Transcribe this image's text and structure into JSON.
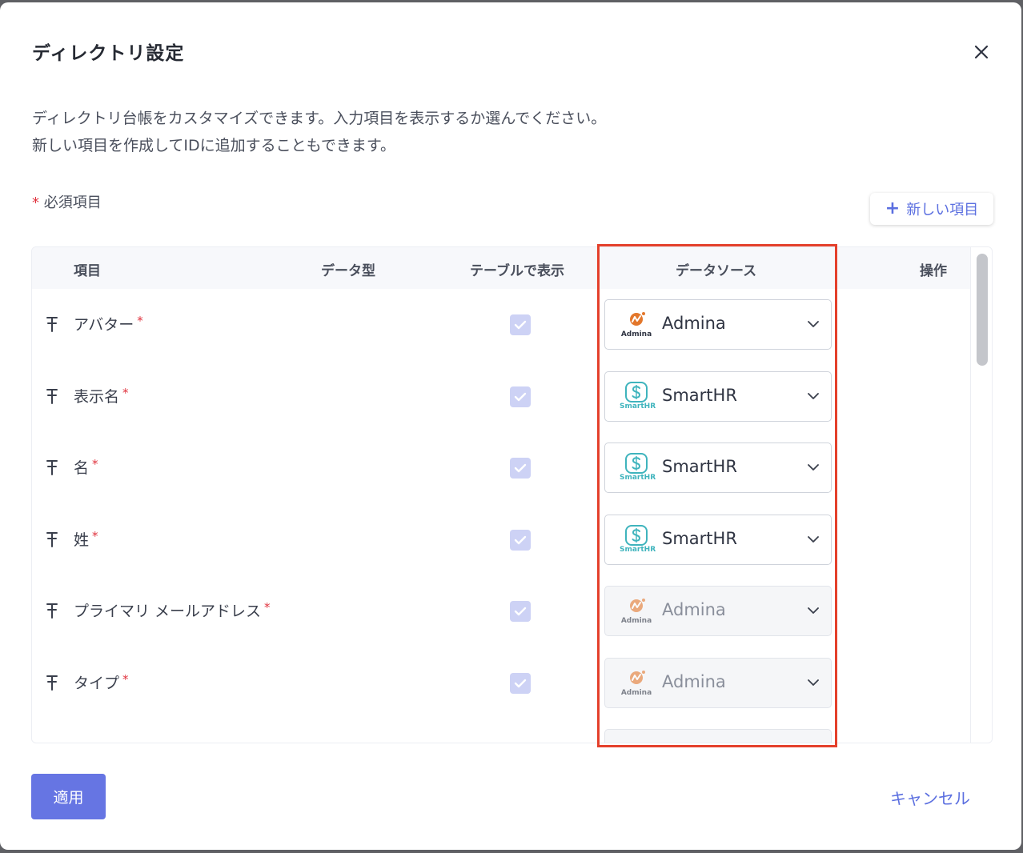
{
  "dialog": {
    "title": "ディレクトリ設定",
    "description_line1": "ディレクトリ台帳をカスタマイズできます。入力項目を表示するか選んでください。",
    "description_line2": "新しい項目を作成してIDに追加することもできます。",
    "required_star": "*",
    "required_note": "必須項目",
    "new_item_label": "新しい項目",
    "apply_label": "適用",
    "cancel_label": "キャンセル"
  },
  "table": {
    "headers": {
      "item": "項目",
      "data_type": "データ型",
      "show_in_table": "テーブルで表示",
      "data_source": "データソース",
      "actions": "操作"
    },
    "rows": [
      {
        "label": "アバター",
        "required": "*",
        "show_in_table": true,
        "source": "Admina",
        "source_logo": "Admina",
        "disabled": false
      },
      {
        "label": "表示名",
        "required": "*",
        "show_in_table": true,
        "source": "SmartHR",
        "source_logo": "SmartHR",
        "disabled": false
      },
      {
        "label": "名",
        "required": "*",
        "show_in_table": true,
        "source": "SmartHR",
        "source_logo": "SmartHR",
        "disabled": false
      },
      {
        "label": "姓",
        "required": "*",
        "show_in_table": true,
        "source": "SmartHR",
        "source_logo": "SmartHR",
        "disabled": false
      },
      {
        "label": "プライマリ メールアドレス",
        "required": "*",
        "show_in_table": true,
        "source": "Admina",
        "source_logo": "Admina",
        "disabled": true
      },
      {
        "label": "タイプ",
        "required": "*",
        "show_in_table": true,
        "source": "Admina",
        "source_logo": "Admina",
        "disabled": true
      }
    ]
  },
  "colors": {
    "accent": "#6675e3",
    "link": "#5b6fe0",
    "required": "#e0333e",
    "highlight": "#e4402b",
    "admina": "#e3772b",
    "smarthr": "#3fb4bd"
  },
  "icons": {
    "close": "close-icon",
    "pin": "pin-icon",
    "check": "check-icon",
    "chevron": "chevron-down-icon",
    "plus": "plus-icon"
  }
}
